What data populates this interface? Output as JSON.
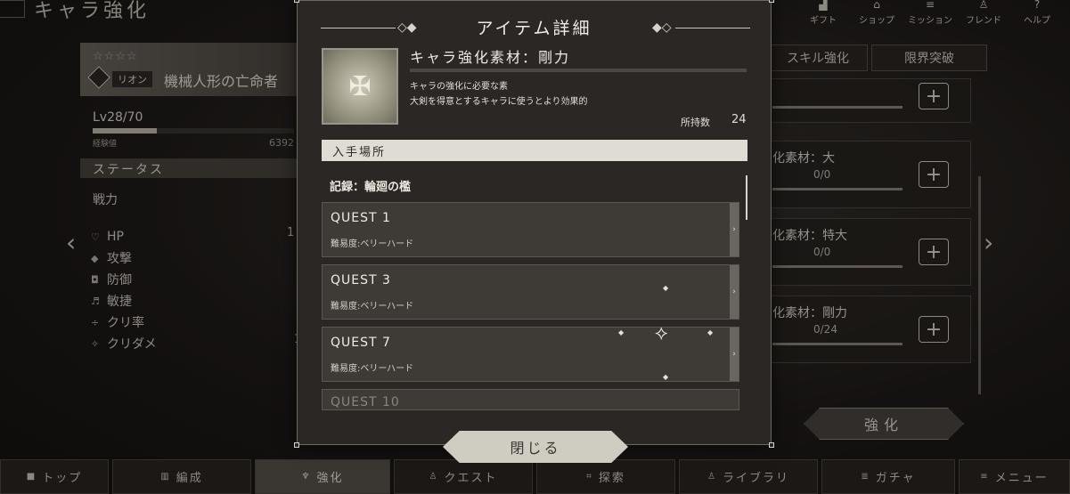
{
  "screen": {
    "title": "キャラ強化"
  },
  "top_nav": [
    {
      "label": "ギフト",
      "icon": "gift-icon"
    },
    {
      "label": "ショップ",
      "icon": "cart-icon"
    },
    {
      "label": "ミッション",
      "icon": "mission-icon"
    },
    {
      "label": "フレンド",
      "icon": "friend-icon"
    },
    {
      "label": "ヘルプ",
      "icon": "help-icon"
    }
  ],
  "character": {
    "stars": "☆☆☆☆",
    "tag": "リオン",
    "name": "機械人形の亡命者",
    "level": "Lv28/70",
    "exp_label": "経験値",
    "exp_value": "6392",
    "exp_progress": 0.32
  },
  "status": {
    "header": "ステータス",
    "power_label": "戦力",
    "stats": [
      {
        "icon": "hp-icon",
        "label": "HP"
      },
      {
        "icon": "attack-icon",
        "label": "攻撃"
      },
      {
        "icon": "defense-icon",
        "label": "防御"
      },
      {
        "icon": "agility-icon",
        "label": "敏捷"
      },
      {
        "icon": "crit-rate-icon",
        "label": "クリ率"
      },
      {
        "icon": "crit-damage-icon",
        "label": "クリダメ"
      }
    ],
    "hp_partial_value": "1",
    "crit_partial_value": "1"
  },
  "right_panel": {
    "tabs": [
      "スキル強化",
      "限界突破"
    ],
    "materials": [
      {
        "title": "化素材：大",
        "count": "0/0"
      },
      {
        "title": "化素材：特大",
        "count": "0/0"
      },
      {
        "title": "化素材：剛力",
        "count": "0/24"
      }
    ],
    "enhance_label": "強化"
  },
  "modal": {
    "title": "アイテム詳細",
    "item_name": "キャラ強化素材：剛力",
    "desc_line1": "キャラの強化に必要な素",
    "desc_line2": "大剣を得意とするキャラに使うとより効果的",
    "owned_label": "所持数",
    "owned_value": "24",
    "source_header": "入手場所",
    "record_label": "記録：輪廻の檻",
    "quests": [
      {
        "name": "QUEST 1",
        "difficulty": "難易度:ベリーハード"
      },
      {
        "name": "QUEST 3",
        "difficulty": "難易度:ベリーハード"
      },
      {
        "name": "QUEST 7",
        "difficulty": "難易度:ベリーハード"
      },
      {
        "name": "QUEST 10",
        "difficulty": ""
      }
    ],
    "close_label": "閉じる"
  },
  "bottom_nav": [
    {
      "label": "トップ",
      "icon": "home-icon",
      "active": false
    },
    {
      "label": "編成",
      "icon": "formation-icon",
      "active": false
    },
    {
      "label": "強化",
      "icon": "enhance-icon",
      "active": true
    },
    {
      "label": "クエスト",
      "icon": "quest-icon",
      "active": false
    },
    {
      "label": "探索",
      "icon": "explore-icon",
      "active": false
    },
    {
      "label": "ライブラリ",
      "icon": "library-icon",
      "active": false
    },
    {
      "label": "ガチャ",
      "icon": "gacha-icon",
      "active": false
    },
    {
      "label": "メニュー",
      "icon": "menu-icon",
      "active": false
    }
  ]
}
